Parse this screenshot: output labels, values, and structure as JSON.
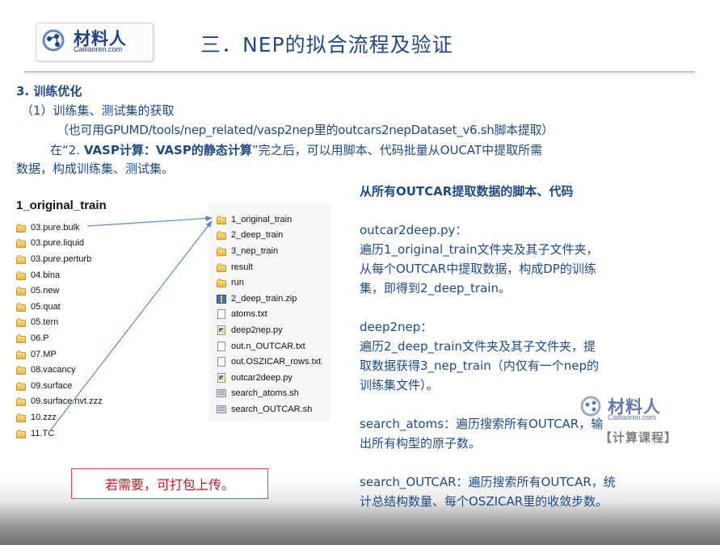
{
  "logo": {
    "name_cn": "材料人",
    "name_en": "Cailiaoren.com"
  },
  "title": "三．NEP的拟合流程及验证",
  "section": {
    "heading": "3. 训练优化",
    "sub": "（1）训练集、测试集的获取",
    "note_path": "（也可用GPUMD/tools/nep_related/vasp2nep里的outcars2nepDataset_v6.sh脚本提取）",
    "intro_prefix": "在“2. ",
    "intro_bold": "VASP计算：VASP的静态计算",
    "intro_suffix": "”完之后，可以用脚本、代码批量从OUCAT中提取所需",
    "intro_line2": "数据，构成训练集、测试集。"
  },
  "left_panel": {
    "title": "1_original_train",
    "items": [
      "03.pure.bulk",
      "03.pure.liquid",
      "03.pure.perturb",
      "04.bina",
      "05.new",
      "05.quat",
      "05.tern",
      "06.P",
      "07.MP",
      "08.vacancy",
      "09.surface",
      "09.surface.nvt.zzz",
      "10.zzz",
      "11.TC"
    ]
  },
  "right_panel": {
    "items": [
      {
        "name": "1_original_train",
        "icon": "folder-icon"
      },
      {
        "name": "2_deep_train",
        "icon": "folder-icon"
      },
      {
        "name": "3_nep_train",
        "icon": "folder-icon"
      },
      {
        "name": "result",
        "icon": "folder-icon"
      },
      {
        "name": "run",
        "icon": "folder-icon"
      },
      {
        "name": "2_deep_train.zip",
        "icon": "zip-icon"
      },
      {
        "name": "atoms.txt",
        "icon": "text-file-icon"
      },
      {
        "name": "deep2nep.py",
        "icon": "python-file-icon"
      },
      {
        "name": "out.n_OUTCAR.txt",
        "icon": "text-file-icon"
      },
      {
        "name": "out.OSZICAR_rows.txt",
        "icon": "text-file-icon"
      },
      {
        "name": "outcar2deep.py",
        "icon": "python-file-icon"
      },
      {
        "name": "search_atoms.sh",
        "icon": "shell-script-icon"
      },
      {
        "name": "search_OUTCAR.sh",
        "icon": "shell-script-icon"
      }
    ]
  },
  "explanations": {
    "header": "从所有OUTCAR提取数据的脚本、代码",
    "outcar2deep_title": "outcar2deep.py：",
    "outcar2deep_l1": "遍历1_original_train文件夹及其子文件夹，",
    "outcar2deep_l2": "从每个OUTCAR中提取数据，构成DP的训练",
    "outcar2deep_l3": "集，即得到2_deep_train。",
    "deep2nep_title": "deep2nep：",
    "deep2nep_l1": "遍历2_deep_train文件夹及其子文件夹，提",
    "deep2nep_l2": "取数据获得3_nep_train（内仅有一个nep的",
    "deep2nep_l3": "训练集文件）。",
    "search_atoms_l1": "search_atoms：遍历搜索所有OUTCAR，输",
    "search_atoms_l2": "出所有构型的原子数。",
    "search_outcar_l1": "search_OUTCAR：遍历搜索所有OUTCAR，统",
    "search_outcar_l2": "计总结构数量、每个OSZICAR里的收敛步数。"
  },
  "note_box": "若需要，可打包上传。",
  "watermark": {
    "name_cn": "材料人",
    "name_en": "Cailiaoren.com",
    "course": "【计算课程】"
  },
  "colors": {
    "text_blue": "#1d4a86",
    "note_red": "#c8161d",
    "arrow": "#5b86c9"
  }
}
